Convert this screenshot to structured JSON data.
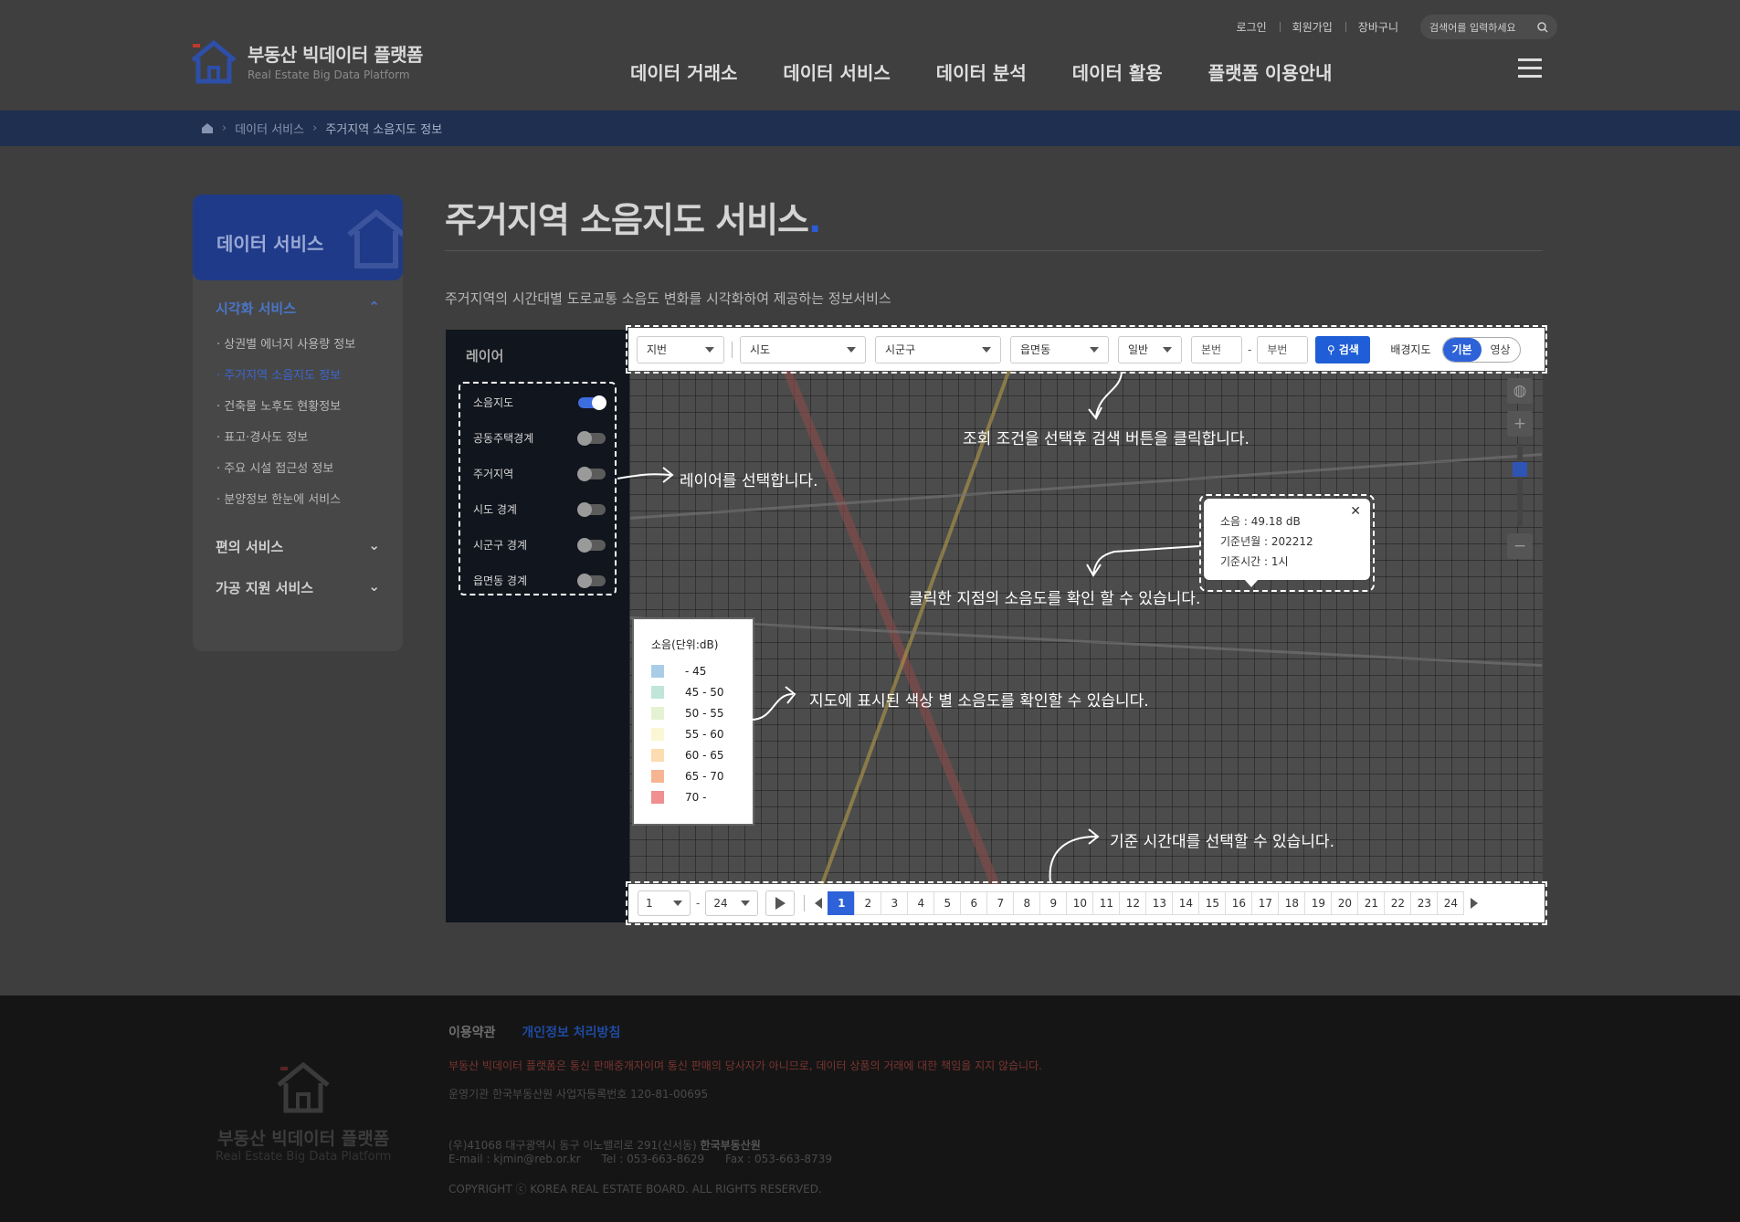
{
  "header": {
    "util_links": [
      "로그인",
      "회원가입",
      "장바구니"
    ],
    "search_placeholder": "검색어를 입력하세요",
    "logo_ko": "부동산 빅데이터 플랫폼",
    "logo_en": "Real Estate Big Data Platform",
    "nav": [
      "데이터 거래소",
      "데이터 서비스",
      "데이터 분석",
      "데이터 활용",
      "플랫폼 이용안내"
    ]
  },
  "breadcrumb": [
    "데이터 서비스",
    "주거지역 소음지도 정보"
  ],
  "sidebar": {
    "title": "데이터 서비스",
    "groups": [
      {
        "label": "시각화 서비스",
        "expanded": true,
        "items": [
          "상권별 에너지 사용량 정보",
          "주거지역 소음지도 정보",
          "건축물 노후도 현황정보",
          "표고·경사도 정보",
          "주요 시설 접근성 정보",
          "분양정보 한눈에 서비스"
        ],
        "active_index": 1
      },
      {
        "label": "편의 서비스",
        "expanded": false
      },
      {
        "label": "가공 지원 서비스",
        "expanded": false
      }
    ]
  },
  "page": {
    "title": "주거지역 소음지도 서비스",
    "title_dot": ".",
    "description": "주거지역의 시간대별 도로교통 소음도 변화를 시각화하여 제공하는 정보서비스"
  },
  "layer_panel": {
    "title": "레이어",
    "layers": [
      {
        "label": "소음지도",
        "on": true
      },
      {
        "label": "공동주택경계",
        "on": false
      },
      {
        "label": "주거지역",
        "on": false
      },
      {
        "label": "시도 경계",
        "on": false
      },
      {
        "label": "시군구 경계",
        "on": false
      },
      {
        "label": "읍면동 경계",
        "on": false
      }
    ]
  },
  "search_bar": {
    "selects": [
      "지번",
      "시도",
      "시군구",
      "읍면동",
      "일반"
    ],
    "main_no_placeholder": "본번",
    "dash": "-",
    "sub_no_placeholder": "부번",
    "search_label": "검색",
    "basemap_label": "배경지도",
    "basemap_options": [
      "기본",
      "영상"
    ],
    "basemap_selected": "기본"
  },
  "legend": {
    "title": "소음(단위:dB)",
    "items": [
      {
        "label": "- 45",
        "color": "#a9cde6"
      },
      {
        "label": "45 - 50",
        "color": "#bfe6d8"
      },
      {
        "label": "50 - 55",
        "color": "#e4f2d3"
      },
      {
        "label": "55 - 60",
        "color": "#fbf6d4"
      },
      {
        "label": "60 - 65",
        "color": "#fcdcb0"
      },
      {
        "label": "65 - 70",
        "color": "#f6b493"
      },
      {
        "label": "70 -",
        "color": "#ef8f8f"
      }
    ]
  },
  "popup": {
    "lines": [
      "소음 : 49.18 dB",
      "기준년월 : 202212",
      "기준시간 : 1시"
    ],
    "close": "✕"
  },
  "annotations": {
    "search": "조회 조건을 선택후 검색 버튼을 클릭합니다.",
    "layer": "레이어를 선택합니다.",
    "click": "클릭한 지점의 소음도를 확인 할 수 있습니다.",
    "legend": "지도에 표시된 색상 별 소음도를 확인할 수 있습니다.",
    "time": "기준 시간대를 선택할 수 있습니다."
  },
  "time_bar": {
    "start": "1",
    "range_dash": "-",
    "end": "24",
    "hours": [
      "1",
      "2",
      "3",
      "4",
      "5",
      "6",
      "7",
      "8",
      "9",
      "10",
      "11",
      "12",
      "13",
      "14",
      "15",
      "16",
      "17",
      "18",
      "19",
      "20",
      "21",
      "22",
      "23",
      "24"
    ],
    "selected_hour": "1"
  },
  "map_controls": {
    "zoom_in": "+",
    "zoom_out": "−"
  },
  "footer": {
    "links": [
      "이용약관",
      "개인정보 처리방침"
    ],
    "disclaimer": "부동산 빅데이터 플랫폼은 통신 판매중개자이며 통신 판매의 당사자가 아니므로, 데이터 상품의 거래에 대한 책임을 지지 않습니다.",
    "operator": "운영기관 한국부동산원 사업자등록번호 120-81-00695",
    "address": "(우)41068 대구광역시 동구 이노밸리로 291(신서동)",
    "org": "한국부동산원",
    "contact": "E-mail : kjmin@reb.or.kr      Tel : 053-663-8629      Fax : 053-663-8739",
    "copyright": "COPYRIGHT ⓒ KOREA REAL ESTATE BOARD. ALL RIGHTS RESERVED.",
    "logo_ko": "부동산 빅데이터 플랫폼",
    "logo_en": "Real Estate Big Data Platform"
  }
}
